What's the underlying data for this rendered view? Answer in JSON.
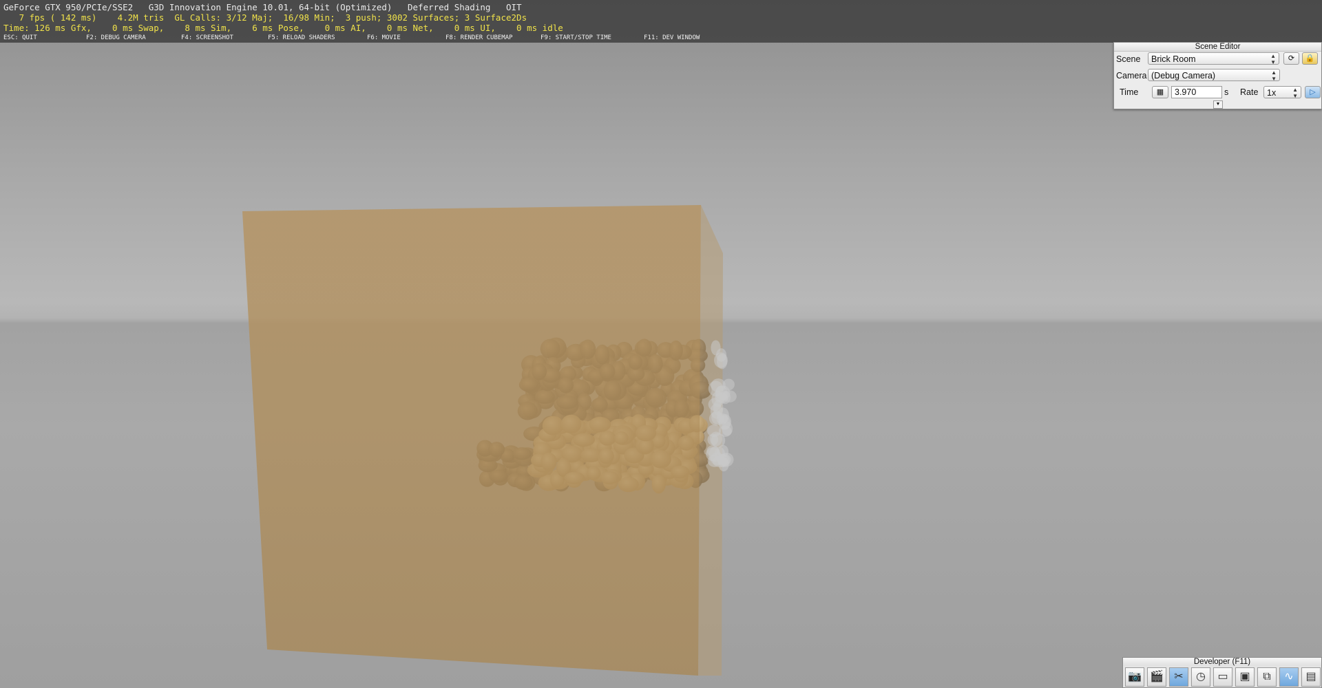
{
  "hud": {
    "line1": "GeForce GTX 950/PCIe/SSE2   G3D Innovation Engine 10.01, 64-bit (Optimized)   Deferred Shading   OIT",
    "line2": "   7 fps ( 142 ms)    4.2M tris  GL Calls: 3/12 Maj;  16/98 Min;  3 push; 3002 Surfaces; 3 Surface2Ds",
    "line3": "Time: 126 ms Gfx,    0 ms Swap,    8 ms Sim,    6 ms Pose,    0 ms AI,    0 ms Net,    0 ms UI,    0 ms idle",
    "keys": [
      "ESC: QUIT",
      "F2: DEBUG CAMERA",
      "F4: SCREENSHOT",
      "F5: RELOAD SHADERS",
      "F6: MOVIE",
      "F8: RENDER CUBEMAP",
      "F9: START/STOP TIME",
      "F11: DEV WINDOW"
    ]
  },
  "scene_editor": {
    "title": "Scene Editor",
    "scene_label": "Scene",
    "scene_value": "Brick Room",
    "camera_label": "Camera",
    "camera_value": "(Debug Camera)",
    "time_label": "Time",
    "time_value": "3.970",
    "time_unit": "s",
    "rate_label": "Rate",
    "rate_value": "1x",
    "reload_icon": "reload-icon",
    "lock_icon": "lock-icon",
    "play_icon": "play-icon"
  },
  "developer": {
    "title": "Developer (F11)",
    "buttons": [
      "camera-icon",
      "film-icon",
      "wrench-icon",
      "clock-icon",
      "note-icon",
      "terminal-icon",
      "window-icon",
      "graph-icon",
      "page-icon"
    ],
    "active_button": "graph-icon"
  },
  "colors": {
    "box": "#b08e5c",
    "hud_yellow": "#f0e24a",
    "accent_blue": "#6fa7dd"
  }
}
